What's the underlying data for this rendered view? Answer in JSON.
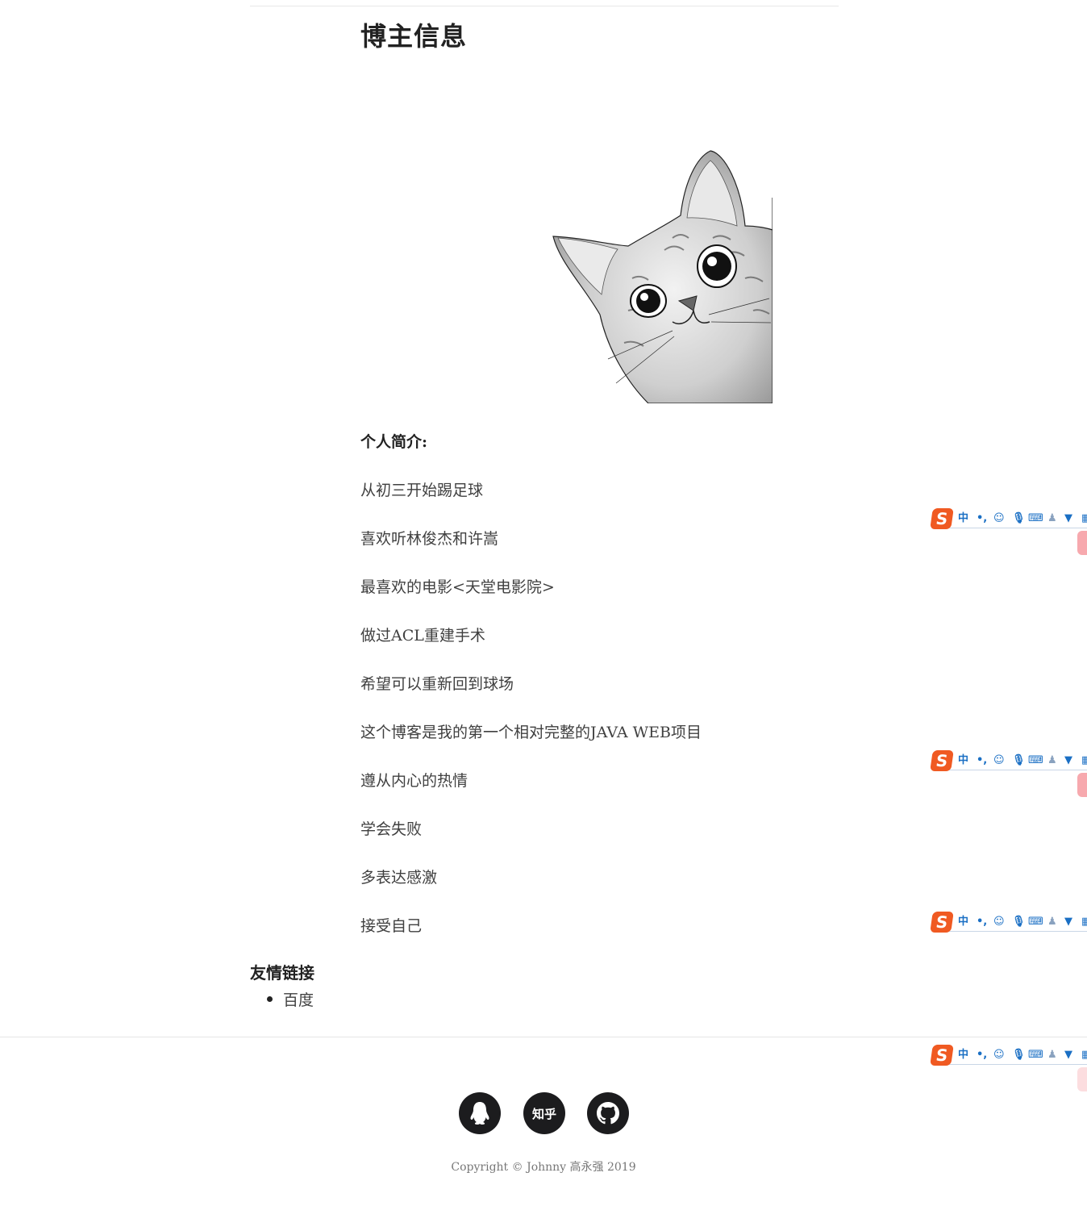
{
  "page": {
    "title": "博主信息"
  },
  "intro": {
    "heading": "个人简介:",
    "lines": [
      "从初三开始踢足球",
      "喜欢听林俊杰和许嵩",
      "最喜欢的电影<天堂电影院>",
      "做过ACL重建手术",
      "希望可以重新回到球场",
      "这个博客是我的第一个相对完整的JAVA WEB项目",
      "遵从内心的热情",
      "学会失败",
      "多表达感激",
      "接受自己"
    ]
  },
  "links": {
    "title": "友情链接",
    "items": [
      "百度"
    ]
  },
  "footer": {
    "social": {
      "qq_icon": "qq-penguin-icon",
      "zhihu_label": "知乎",
      "github_icon": "github-icon"
    },
    "copyright": "Copyright © Johnny 高永强 2019"
  },
  "ime_toolbar": {
    "logo": "S",
    "mode": "中",
    "punct": "•,",
    "icons": [
      "smile-icon",
      "microphone-icon",
      "keyboard-icon",
      "user-icon",
      "shirt-icon",
      "grid-icon"
    ]
  },
  "colors": {
    "social_bg": "#1c1c1e",
    "ime_accent": "#1a6fc4",
    "ime_logo": "#f05a22"
  }
}
